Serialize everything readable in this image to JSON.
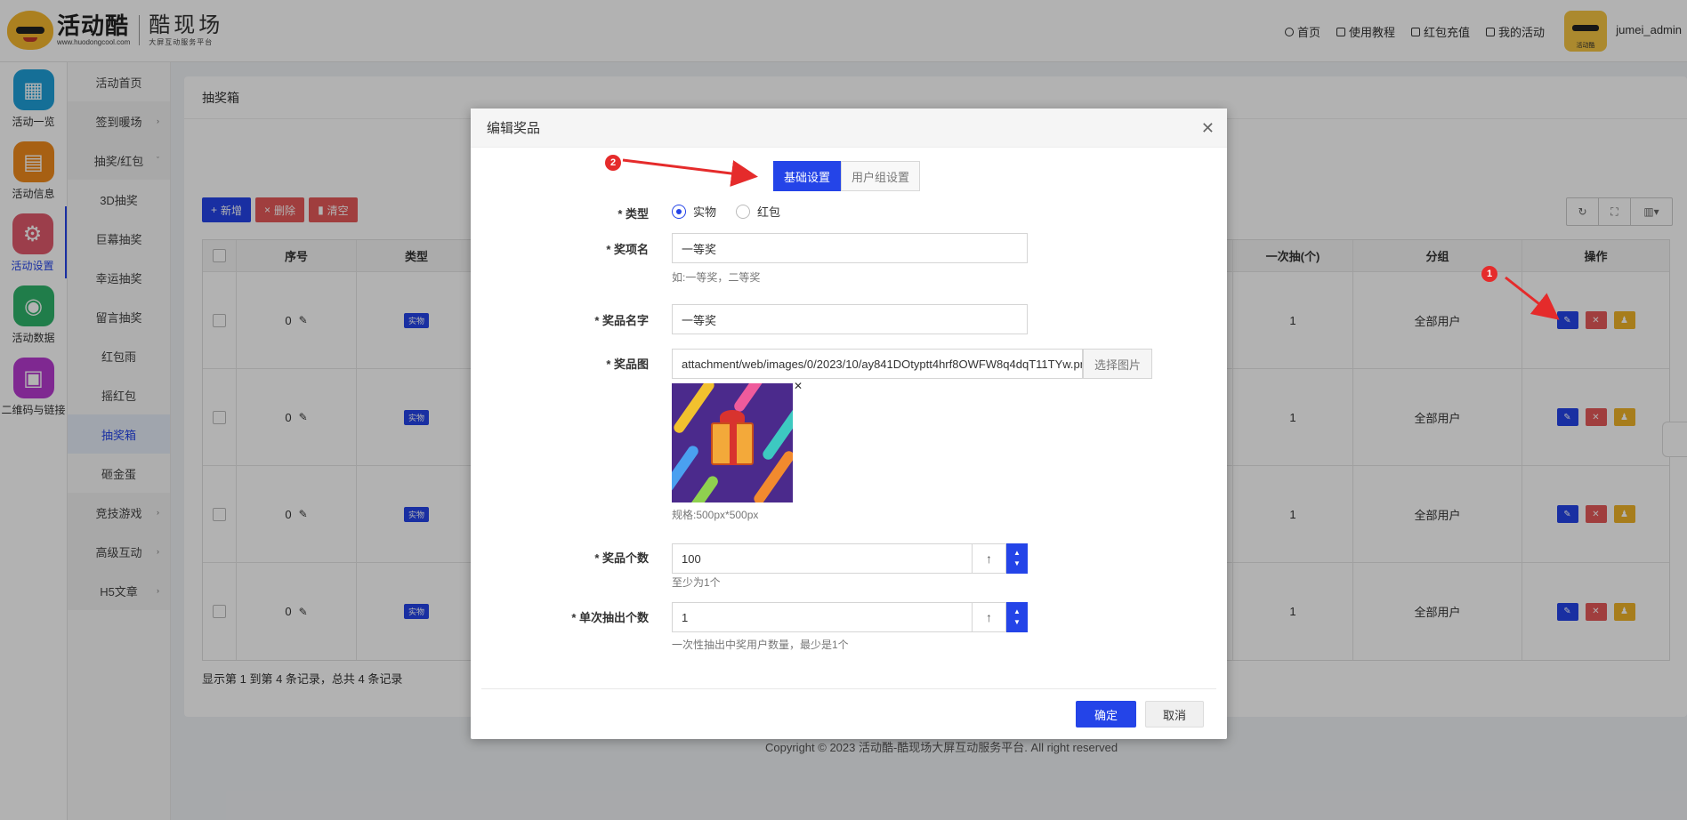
{
  "header": {
    "logo_main": "活动酷",
    "logo_url": "www.huodongcool.com",
    "logo_sub_main": "酷现场",
    "logo_sub_small": "大屏互动服务平台",
    "nav": [
      "首页",
      "使用教程",
      "红包充值",
      "我的活动"
    ],
    "avatar_caption": "活动酷",
    "username": "jumei_admin"
  },
  "icon_sidebar": [
    {
      "label": "活动一览",
      "icon": "grid-icon",
      "color": "#1fa0d8"
    },
    {
      "label": "活动信息",
      "icon": "document-icon",
      "color": "#f08a1c"
    },
    {
      "label": "活动设置",
      "icon": "gear-icon",
      "color": "#e05a6c"
    },
    {
      "label": "活动数据",
      "icon": "database-icon",
      "color": "#2fb36a"
    },
    {
      "label": "二维码与链接",
      "icon": "qrcode-icon",
      "color": "#b63ad0"
    }
  ],
  "sub_sidebar": [
    {
      "label": "活动首页",
      "type": "item"
    },
    {
      "label": "签到暖场",
      "type": "group",
      "arrow": "›"
    },
    {
      "label": "抽奖/红包",
      "type": "group",
      "arrow": "ˇ"
    },
    {
      "label": "3D抽奖",
      "type": "item"
    },
    {
      "label": "巨幕抽奖",
      "type": "item"
    },
    {
      "label": "幸运抽奖",
      "type": "item"
    },
    {
      "label": "留言抽奖",
      "type": "item"
    },
    {
      "label": "红包雨",
      "type": "item"
    },
    {
      "label": "摇红包",
      "type": "item"
    },
    {
      "label": "抽奖箱",
      "type": "active"
    },
    {
      "label": "砸金蛋",
      "type": "item"
    },
    {
      "label": "竞技游戏",
      "type": "group",
      "arrow": "›"
    },
    {
      "label": "高级互动",
      "type": "group",
      "arrow": "›"
    },
    {
      "label": "H5文章",
      "type": "group",
      "arrow": "›"
    }
  ],
  "content": {
    "title": "抽奖箱",
    "toolbar": {
      "add": "新增",
      "delete": "删除",
      "clear": "清空"
    },
    "table": {
      "headers": {
        "num": "序号",
        "type": "类型",
        "once": "一次抽(个)",
        "group": "分组",
        "ops": "操作"
      },
      "rows": [
        {
          "num": "0",
          "type": "实物",
          "once": "1",
          "group": "全部用户"
        },
        {
          "num": "0",
          "type": "实物",
          "once": "1",
          "group": "全部用户"
        },
        {
          "num": "0",
          "type": "实物",
          "once": "1",
          "group": "全部用户"
        },
        {
          "num": "0",
          "type": "实物",
          "once": "1",
          "group": "全部用户"
        }
      ]
    },
    "pager": "显示第 1 到第 4 条记录，总共 4 条记录"
  },
  "copyright": "Copyright © 2023 活动酷-酷现场大屏互动服务平台. All right reserved",
  "modal": {
    "title": "编辑奖品",
    "tabs": [
      "基础设置",
      "用户组设置"
    ],
    "type_label": "* 类型",
    "type_options": [
      "实物",
      "红包"
    ],
    "award_label": "* 奖项名",
    "award_value": "一等奖",
    "award_hint": "如:一等奖，二等奖",
    "prize_name_label": "* 奖品名字",
    "prize_name_value": "一等奖",
    "prize_img_label": "* 奖品图",
    "prize_img_value": "attachment/web/images/0/2023/10/ay841DOtyptt4hrf8OWFW8q4dqT11TYw.png",
    "pick_image": "选择图片",
    "img_spec": "规格:500px*500px",
    "count_label": "* 奖品个数",
    "count_value": "100",
    "count_hint": "至少为1个",
    "per_draw_label": "* 单次抽出个数",
    "per_draw_value": "1",
    "per_draw_hint": "一次性抽出中奖用户数量，最少是1个",
    "confirm": "确定",
    "cancel": "取消"
  },
  "annotations": {
    "marker1": "1",
    "marker2": "2",
    "color": "#e52b2b"
  }
}
